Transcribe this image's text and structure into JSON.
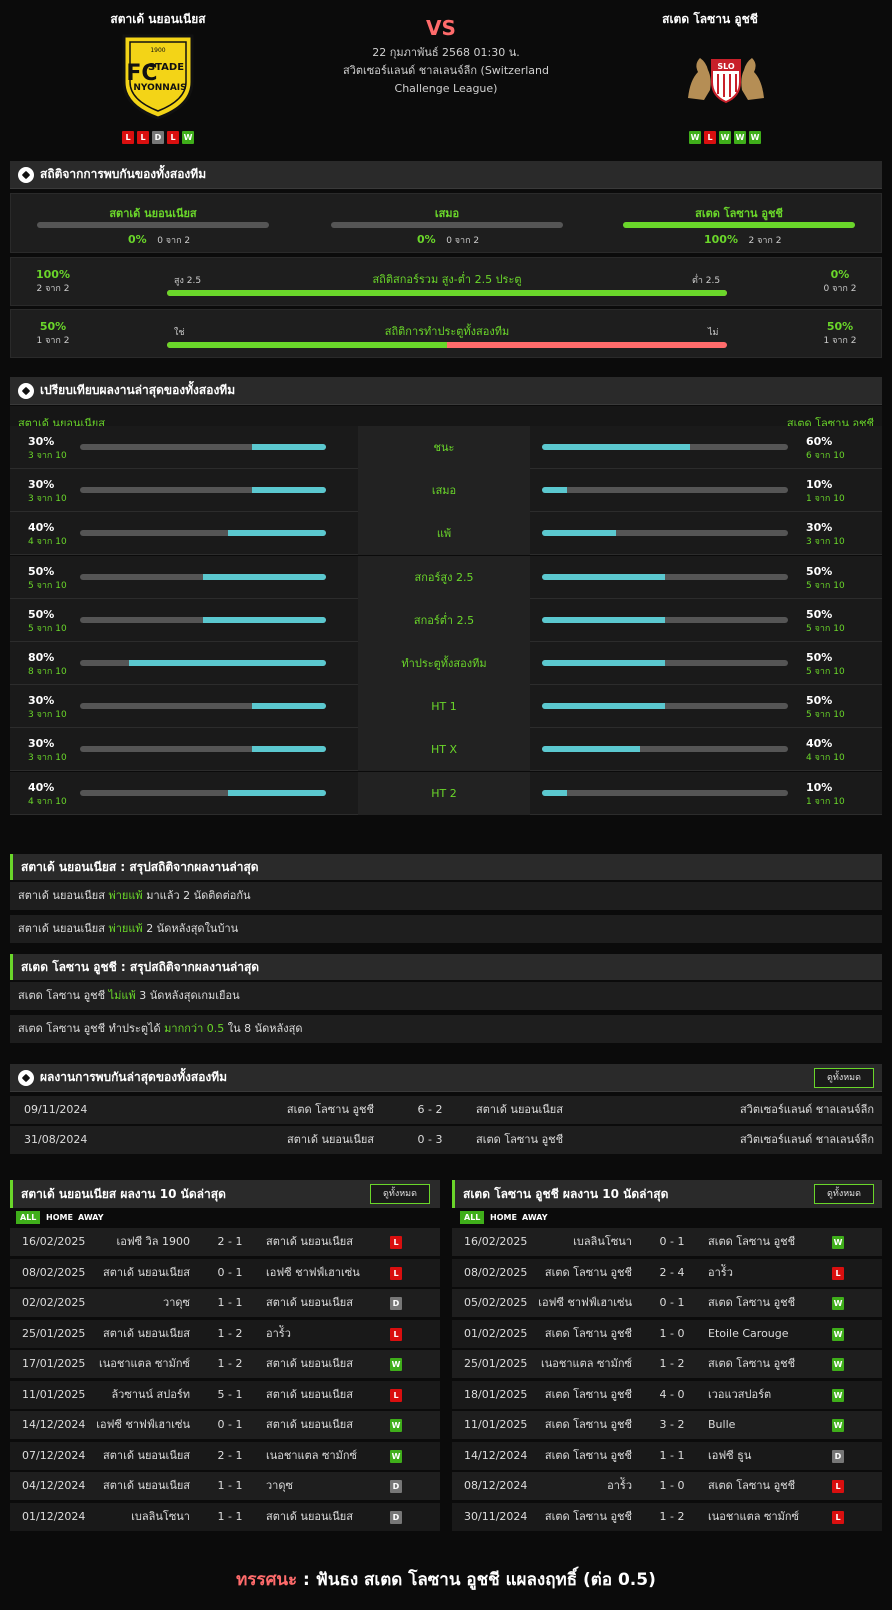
{
  "header": {
    "home_team": "สตาเด้ นยอนเนียส",
    "away_team": "สเตด โลซาน อูชชี",
    "vs": "VS",
    "date": "22 กุมภาพันธ์ 2568 01:30 น.",
    "league": "สวิตเซอร์แลนด์ ชาลเลนจ์ลีก (Switzerland Challenge League)",
    "home_logo_text": [
      "1900",
      "FC",
      "STADE",
      "NYONNAIS"
    ],
    "away_logo_text": "SLO",
    "home_form": [
      "L",
      "L",
      "D",
      "L",
      "W"
    ],
    "away_form": [
      "W",
      "L",
      "W",
      "W",
      "W"
    ]
  },
  "h2h_stats": {
    "title": "สถิติจากการพบกันของทั้งสองทีม",
    "home": {
      "label": "สตาเด้ นยอนเนียส",
      "pct": "0%",
      "of": "0 จาก 2",
      "value": 0
    },
    "draw": {
      "label": "เสมอ",
      "pct": "0%",
      "of": "0 จาก 2",
      "value": 0
    },
    "away": {
      "label": "สเตด โลซาน อูชชี",
      "pct": "100%",
      "of": "2 จาก 2",
      "value": 100
    },
    "ou": {
      "title": "สถิติสกอร์รวม สูง-ต่ำ 2.5 ประตู",
      "left_label": "สูง 2.5",
      "right_label": "ต่ำ 2.5",
      "left_pct": "100%",
      "left_of": "2 จาก 2",
      "right_pct": "0%",
      "right_of": "0 จาก 2",
      "value": 100
    },
    "btts": {
      "title": "สถิติการทำประตูทั้งสองทีม",
      "left_label": "ใช่",
      "right_label": "ไม่",
      "left_pct": "50%",
      "left_of": "1 จาก 2",
      "right_pct": "50%",
      "right_of": "1 จาก 2",
      "value": 50
    }
  },
  "compare": {
    "title": "เปรียบเทียบผลงานล่าสุดของทั้งสองทีม",
    "home_label": "สตาเด้ นยอนเนียส",
    "away_label": "สเตด โลซาน อูชชี",
    "rows": [
      {
        "label": "ชนะ",
        "hp": "30%",
        "ho": "3 จาก 10",
        "hv": 30,
        "ap": "60%",
        "ao": "6 จาก 10",
        "av": 60
      },
      {
        "label": "เสมอ",
        "hp": "30%",
        "ho": "3 จาก 10",
        "hv": 30,
        "ap": "10%",
        "ao": "1 จาก 10",
        "av": 10
      },
      {
        "label": "แพ้",
        "hp": "40%",
        "ho": "4 จาก 10",
        "hv": 40,
        "ap": "30%",
        "ao": "3 จาก 10",
        "av": 30
      },
      {
        "label": "สกอร์สูง 2.5",
        "hp": "50%",
        "ho": "5 จาก 10",
        "hv": 50,
        "ap": "50%",
        "ao": "5 จาก 10",
        "av": 50
      },
      {
        "label": "สกอร์ต่ำ 2.5",
        "hp": "50%",
        "ho": "5 จาก 10",
        "hv": 50,
        "ap": "50%",
        "ao": "5 จาก 10",
        "av": 50
      },
      {
        "label": "ทำประตูทั้งสองทีม",
        "hp": "80%",
        "ho": "8 จาก 10",
        "hv": 80,
        "ap": "50%",
        "ao": "5 จาก 10",
        "av": 50
      },
      {
        "label": "HT 1",
        "hp": "30%",
        "ho": "3 จาก 10",
        "hv": 30,
        "ap": "50%",
        "ao": "5 จาก 10",
        "av": 50
      },
      {
        "label": "HT X",
        "hp": "30%",
        "ho": "3 จาก 10",
        "hv": 30,
        "ap": "40%",
        "ao": "4 จาก 10",
        "av": 40
      },
      {
        "label": "HT 2",
        "hp": "40%",
        "ho": "4 จาก 10",
        "hv": 40,
        "ap": "10%",
        "ao": "1 จาก 10",
        "av": 10
      }
    ]
  },
  "summary_home": {
    "title": "สตาเด้ นยอนเนียส : สรุปสถิติจากผลงานล่าสุด",
    "rows": [
      {
        "a": "สตาเด้ นยอนเนียส",
        "b": "พ่ายแพ้",
        "c": "มาแล้ว 2 นัดติดต่อกัน"
      },
      {
        "a": "สตาเด้ นยอนเนียส",
        "b": "พ่ายแพ้",
        "c": "2  นัดหลังสุดในบ้าน"
      }
    ]
  },
  "summary_away": {
    "title": "สเตด โลซาน อูชชี : สรุปสถิติจากผลงานล่าสุด",
    "rows": [
      {
        "a": "สเตด โลซาน อูชชี",
        "b": "ไม่แพ้",
        "c": "3  นัดหลังสุดเกมเยือน"
      },
      {
        "a": "สเตด โลซาน อูชชี  ทำประตูได้",
        "b": "มากกว่า  0.5",
        "c": "ใน 8 นัดหลังสุด"
      }
    ]
  },
  "h2h": {
    "title": "ผลงานการพบกันล่าสุดของทั้งสองทีม",
    "view_all": "ดูทั้งหมด",
    "rows": [
      {
        "date": "09/11/2024",
        "home": "สเตด โลซาน อูชชี",
        "score": "6 - 2",
        "away": "สตาเด้ นยอนเนียส",
        "league": "สวิตเซอร์แลนด์ ชาลเลนจ์ลีก"
      },
      {
        "date": "31/08/2024",
        "home": "สตาเด้ นยอนเนียส",
        "score": "0 - 3",
        "away": "สเตด โลซาน อูชชี",
        "league": "สวิตเซอร์แลนด์ ชาลเลนจ์ลีก"
      }
    ]
  },
  "last10_home": {
    "title": "สตาเด้ นยอนเนียส ผลงาน 10 นัดล่าสุด",
    "view_all": "ดูทั้งหมด",
    "tabs": [
      "ALL",
      "HOME",
      "AWAY"
    ],
    "rows": [
      {
        "date": "16/02/2025",
        "home": "เอฟซี วิล 1900",
        "score": "2 - 1",
        "away": "สตาเด้ นยอนเนียส",
        "res": "L"
      },
      {
        "date": "08/02/2025",
        "home": "สตาเด้ นยอนเนียส",
        "score": "0 - 1",
        "away": "เอฟซี ชาฟฟ์เฮาเซ่น",
        "res": "L"
      },
      {
        "date": "02/02/2025",
        "home": "วาดุซ",
        "score": "1 - 1",
        "away": "สตาเด้ นยอนเนียส",
        "res": "D"
      },
      {
        "date": "25/01/2025",
        "home": "สตาเด้ นยอนเนียส",
        "score": "1 - 2",
        "away": "อาร์ัว",
        "res": "L"
      },
      {
        "date": "17/01/2025",
        "home": "เนอชาแตล ซามักซ์",
        "score": "1 - 2",
        "away": "สตาเด้ นยอนเนียส",
        "res": "W"
      },
      {
        "date": "11/01/2025",
        "home": "ล้วซานน์ สปอร์ท",
        "score": "5 - 1",
        "away": "สตาเด้ นยอนเนียส",
        "res": "L"
      },
      {
        "date": "14/12/2024",
        "home": "เอฟซี ชาฟฟ์เฮาเซ่น",
        "score": "0 - 1",
        "away": "สตาเด้ นยอนเนียส",
        "res": "W"
      },
      {
        "date": "07/12/2024",
        "home": "สตาเด้ นยอนเนียส",
        "score": "2 - 1",
        "away": "เนอชาแตล ซามักซ์",
        "res": "W"
      },
      {
        "date": "04/12/2024",
        "home": "สตาเด้ นยอนเนียส",
        "score": "1 - 1",
        "away": "วาดุซ",
        "res": "D"
      },
      {
        "date": "01/12/2024",
        "home": "เบลลินโซนา",
        "score": "1 - 1",
        "away": "สตาเด้ นยอนเนียส",
        "res": "D"
      }
    ]
  },
  "last10_away": {
    "title": "สเตด โลซาน อูชชี ผลงาน 10 นัดล่าสุด",
    "view_all": "ดูทั้งหมด",
    "tabs": [
      "ALL",
      "HOME",
      "AWAY"
    ],
    "rows": [
      {
        "date": "16/02/2025",
        "home": "เบลลินโซนา",
        "score": "0 - 1",
        "away": "สเตด โลซาน อูชชี",
        "res": "W"
      },
      {
        "date": "08/02/2025",
        "home": "สเตด โลซาน อูชชี",
        "score": "2 - 4",
        "away": "อาร์ัว",
        "res": "L"
      },
      {
        "date": "05/02/2025",
        "home": "เอฟซี ชาฟฟ์เฮาเซ่น",
        "score": "0 - 1",
        "away": "สเตด โลซาน อูชชี",
        "res": "W"
      },
      {
        "date": "01/02/2025",
        "home": "สเตด โลซาน อูชชี",
        "score": "1 - 0",
        "away": "Etoile Carouge",
        "res": "W"
      },
      {
        "date": "25/01/2025",
        "home": "เนอชาแตล ซามักซ์",
        "score": "1 - 2",
        "away": "สเตด โลซาน อูชชี",
        "res": "W"
      },
      {
        "date": "18/01/2025",
        "home": "สเตด โลซาน อูชชี",
        "score": "4 - 0",
        "away": "เวอแวสปอร์ต",
        "res": "W"
      },
      {
        "date": "11/01/2025",
        "home": "สเตด โลซาน อูชชี",
        "score": "3 - 2",
        "away": "Bulle",
        "res": "W"
      },
      {
        "date": "14/12/2024",
        "home": "สเตด โลซาน อูชชี",
        "score": "1 - 1",
        "away": "เอฟซี ธูน",
        "res": "D"
      },
      {
        "date": "08/12/2024",
        "home": "อาร์ัว",
        "score": "1 - 0",
        "away": "สเตด โลซาน อูชชี",
        "res": "L"
      },
      {
        "date": "30/11/2024",
        "home": "สเตด โลซาน อูชชี",
        "score": "1 - 2",
        "away": "เนอชาแตล ซามักซ์",
        "res": "L"
      }
    ]
  },
  "verdict": {
    "label": "ทรรศนะ",
    "sep": " :  ",
    "text": "ฟันธง สเตด โลซาน อูชชี แผลงฤทธิ์ (ต่อ 0.5)"
  },
  "colors": {
    "green": "#6ad62a",
    "teal": "#5bc8cf",
    "red": "#ff6b6b",
    "bar_bg": "#555555"
  }
}
